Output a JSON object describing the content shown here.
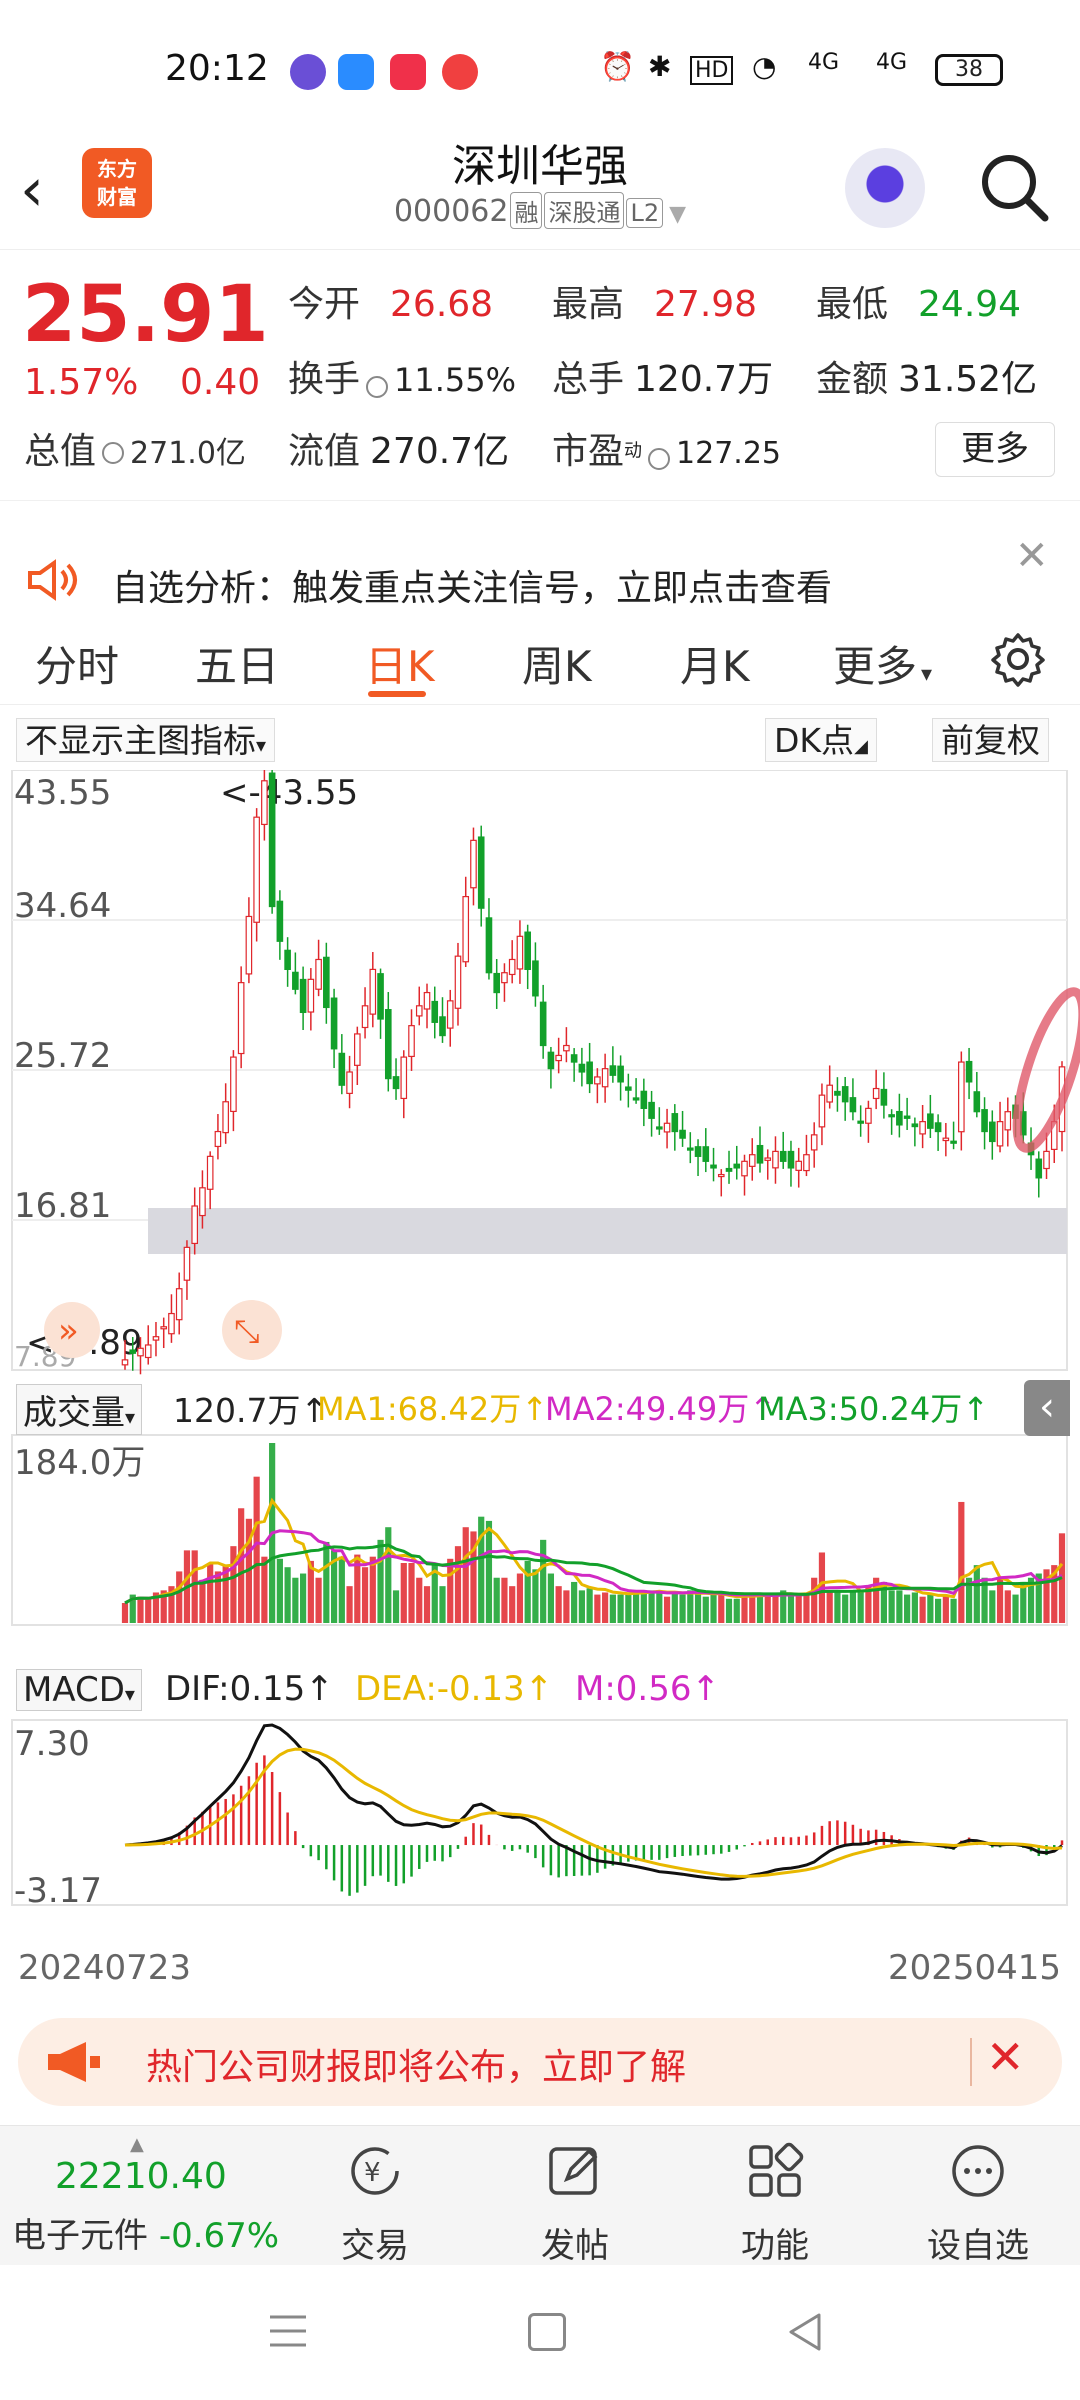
{
  "status_bar": {
    "time": "20:12",
    "network_1": "4G",
    "network_2": "4G",
    "battery": "38",
    "hd": "HD"
  },
  "header": {
    "title": "深圳华强",
    "code": "000062",
    "tags": [
      "融",
      "深股通",
      "L2"
    ],
    "logo_line1": "东方",
    "logo_line2": "财富"
  },
  "quote": {
    "price": "25.91",
    "change_pct": "1.57%",
    "change": "0.40",
    "open_label": "今开",
    "open": "26.68",
    "high_label": "最高",
    "high": "27.98",
    "low_label": "最低",
    "low": "24.94",
    "turnover_label": "换手",
    "turnover": "11.55%",
    "volume_label": "总手",
    "volume": "120.7万",
    "amount_label": "金额",
    "amount": "31.52亿",
    "mktcap_label": "总值",
    "mktcap": "271.0亿",
    "float_label": "流值",
    "float_cap": "270.7亿",
    "pe_label": "市盈",
    "pe_sup": "动",
    "pe": "127.25",
    "more": "更多"
  },
  "notice": {
    "text": "自选分析：触发重点关注信号，立即点击查看"
  },
  "tabs": [
    "分时",
    "五日",
    "日K",
    "周K",
    "月K",
    "更多"
  ],
  "chart_toolbar": {
    "indicator": "不显示主图指标",
    "dk": "DK点",
    "adjust": "前复权"
  },
  "chart_data": [
    {
      "type": "candlestick",
      "title": "日K",
      "y_ticks": [
        "43.55",
        "34.64",
        "25.72",
        "16.81",
        "7.89"
      ],
      "ylim": [
        7.89,
        43.55
      ],
      "max_label": "<-43.55",
      "min_label": "<-7.89",
      "x_start": "20240723",
      "x_end": "20250415",
      "closes": [
        8.2,
        8.6,
        8.9,
        9.1,
        9.6,
        10.2,
        11.0,
        12.5,
        15.0,
        17.5,
        18.6,
        20.5,
        22.0,
        23.8,
        26.5,
        31.0,
        35.0,
        41.0,
        43.2,
        35.6,
        33.5,
        31.8,
        30.6,
        29.2,
        31.2,
        32.4,
        29.5,
        27.0,
        24.8,
        25.6,
        27.9,
        29.6,
        31.8,
        28.8,
        25.2,
        24.6,
        26.5,
        28.4,
        29.6,
        30.4,
        28.6,
        27.8,
        29.9,
        32.6,
        36.2,
        39.6,
        35.5,
        31.6,
        30.4,
        31.6,
        32.4,
        33.8,
        31.8,
        30.2,
        27.2,
        25.8,
        26.6,
        27.2,
        26.2,
        25.6,
        24.9,
        25.3,
        25.8,
        25.4,
        25.0,
        24.5,
        24.0,
        23.4,
        22.8,
        22.2,
        22.5,
        22.0,
        21.6,
        21.0,
        20.5,
        20.2,
        19.8,
        19.4,
        19.6,
        19.8,
        20.2,
        20.6,
        20.1,
        20.4,
        20.8,
        20.2,
        19.8,
        20.2,
        20.6,
        21.8,
        24.2,
        24.8,
        24.2,
        23.8,
        23.2,
        22.6,
        23.4,
        24.6,
        23.6,
        23.0,
        22.4,
        22.8,
        22.3,
        22.6,
        22.2,
        22.0,
        21.6,
        21.4,
        26.2,
        25.0,
        23.2,
        22.0,
        21.4,
        22.6,
        23.2,
        22.8,
        21.8,
        20.6,
        19.2,
        20.8,
        22.6,
        25.91
      ],
      "annotation": "red-highlight-last-bars"
    },
    {
      "type": "bar",
      "title": "成交量",
      "volume_label": "120.7万",
      "ma1": "MA1:68.42万",
      "ma2": "MA2:49.49万",
      "ma3": "MA3:50.24万",
      "y_max_label": "184.0万",
      "colors": {
        "ma1": "#e8b800",
        "ma2": "#d129c4",
        "ma3": "#12a02a"
      }
    },
    {
      "type": "bar",
      "title": "MACD",
      "dif": "DIF:0.15",
      "dea": "DEA:-0.13",
      "m": "M:0.56",
      "y_ticks": [
        "7.30",
        "-3.17"
      ],
      "colors": {
        "dif": "#111111",
        "dea": "#e8b800",
        "m": "#d129c4"
      }
    }
  ],
  "banner": {
    "text": "热门公司财报即将公布，立即了解"
  },
  "bottom_nav": {
    "index_value": "22210.40",
    "index_name": "电子元件",
    "index_change": "-0.67%",
    "items": [
      "交易",
      "发帖",
      "功能",
      "设自选"
    ]
  },
  "colors": {
    "up": "#e0262b",
    "down": "#12a02a",
    "accent": "#f15a24"
  }
}
